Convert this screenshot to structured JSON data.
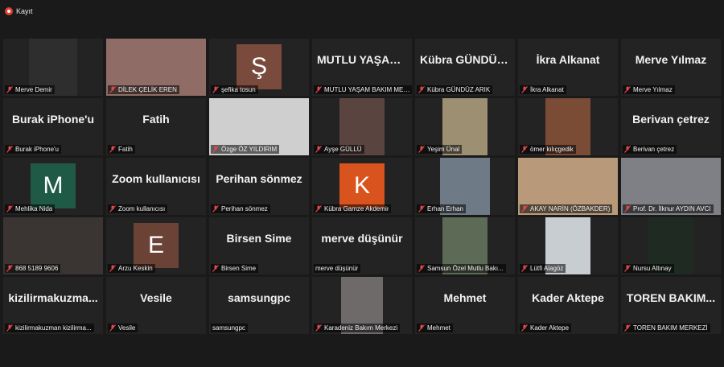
{
  "recording": {
    "label": "Kayıt"
  },
  "participants": [
    {
      "name": "Merve Demir",
      "display": "",
      "kind": "video",
      "bg": "#2e2e2e"
    },
    {
      "name": "DİLEK ÇELİK EREN",
      "display": "",
      "kind": "video",
      "bg": "#8f6d66"
    },
    {
      "name": "şefika tosun",
      "display": "Ş",
      "kind": "avatar",
      "bg": "#7a4a3c"
    },
    {
      "name": "MUTLU YAŞAM BAKIM MER...",
      "display": "MUTLU YAŞAM...",
      "kind": "name"
    },
    {
      "name": "Kübra GÜNDÜZ ARIK",
      "display": "Kübra GÜNDÜZ...",
      "kind": "name"
    },
    {
      "name": "İkra Alkanat",
      "display": "İkra Alkanat",
      "kind": "name"
    },
    {
      "name": "Merve Yılmaz",
      "display": "Merve Yılmaz",
      "kind": "name"
    },
    {
      "name": "Burak iPhone'u",
      "display": "Burak iPhone'u",
      "kind": "name"
    },
    {
      "name": "Fatih",
      "display": "Fatih",
      "kind": "name"
    },
    {
      "name": "Özge ÖZ YILDIRIM",
      "display": "",
      "kind": "video",
      "bg": "#cfcfcf"
    },
    {
      "name": "Ayşe GÜLLÜ",
      "display": "",
      "kind": "video",
      "bg": "#5a4440"
    },
    {
      "name": "Yeşim Ünal",
      "display": "",
      "kind": "video",
      "bg": "#9c8f72"
    },
    {
      "name": "ömer kılıçgedik",
      "display": "",
      "kind": "video",
      "bg": "#7a4b35"
    },
    {
      "name": "Berivan çetrez",
      "display": "Berivan çetrez",
      "kind": "name"
    },
    {
      "name": "Mehlika Nida",
      "display": "M",
      "kind": "avatar",
      "bg": "#1e5a46"
    },
    {
      "name": "Zoom kullanıcısı",
      "display": "Zoom kullanıcısı",
      "kind": "name"
    },
    {
      "name": "Perihan sönmez",
      "display": "Perihan sönmez",
      "kind": "name"
    },
    {
      "name": "Kübra Gamze Akdemir",
      "display": "K",
      "kind": "avatar",
      "bg": "#d9531e"
    },
    {
      "name": "Erhan Erhan",
      "display": "",
      "kind": "video",
      "bg": "#6e7a86"
    },
    {
      "name": "AKAY NARİN (ÖZBAKDER)",
      "display": "",
      "kind": "video",
      "bg": "#b89a7a",
      "full": true
    },
    {
      "name": "Prof. Dr. İlknur AYDIN AVCI",
      "display": "",
      "kind": "video",
      "bg": "#7f7f86",
      "full": true,
      "active": true
    },
    {
      "name": "868 5189 9606",
      "display": "",
      "kind": "video",
      "bg": "#3a3533",
      "full": true
    },
    {
      "name": "Arzu Keskin",
      "display": "E",
      "kind": "avatar",
      "bg": "#6b4236"
    },
    {
      "name": "Birsen Sime",
      "display": "Birsen Sime",
      "kind": "name"
    },
    {
      "name": "merve düşünür",
      "display": "merve düşünür",
      "kind": "name",
      "nomute": true
    },
    {
      "name": "Samsun Özel Mutlu Bakı...",
      "display": "",
      "kind": "video",
      "bg": "#5d6b56"
    },
    {
      "name": "Lütfi Alagöz",
      "display": "",
      "kind": "video",
      "bg": "#c8cdd2"
    },
    {
      "name": "Nursu Altınay",
      "display": "",
      "kind": "video",
      "bg": "#1f2a22"
    },
    {
      "name": "kizilirmakuzman kizilirma...",
      "display": "kizilirmakuzma...",
      "kind": "name"
    },
    {
      "name": "Vesile",
      "display": "Vesile",
      "kind": "name"
    },
    {
      "name": "samsungpc",
      "display": "samsungpc",
      "kind": "name",
      "nomute": true
    },
    {
      "name": "Karadeniz Bakım Merkezi",
      "display": "",
      "kind": "video",
      "bg": "#6f6a6a"
    },
    {
      "name": "Mehmet",
      "display": "Mehmet",
      "kind": "name"
    },
    {
      "name": "Kader Aktepe",
      "display": "Kader Aktepe",
      "kind": "name"
    },
    {
      "name": "TOREN BAKIM MERKEZİ",
      "display": "TOREN BAKIM...",
      "kind": "name"
    }
  ],
  "colors": {
    "accent_active": "#c9e44c",
    "mute_red": "#e5484d",
    "record_red": "#e03e2f"
  }
}
